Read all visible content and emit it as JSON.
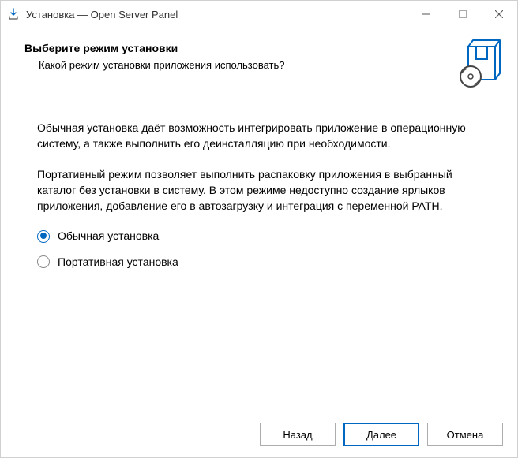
{
  "titlebar": {
    "title": "Установка — Open Server Panel"
  },
  "header": {
    "heading": "Выберите режим установки",
    "subtitle": "Какой режим установки приложения использовать?"
  },
  "body": {
    "paragraph1": "Обычная установка даёт возможность интегрировать приложение в операционную систему, а также выполнить его деинсталляцию при необходимости.",
    "paragraph2": "Портативный режим позволяет выполнить распаковку приложения в выбранный каталог без установки в систему. В этом режиме недоступно создание ярлыков приложения, добавление его в автозагрузку и интеграция с переменной PATH.",
    "options": [
      {
        "label": "Обычная установка",
        "selected": true
      },
      {
        "label": "Портативная установка",
        "selected": false
      }
    ]
  },
  "footer": {
    "back": "Назад",
    "next": "Далее",
    "cancel": "Отмена"
  }
}
